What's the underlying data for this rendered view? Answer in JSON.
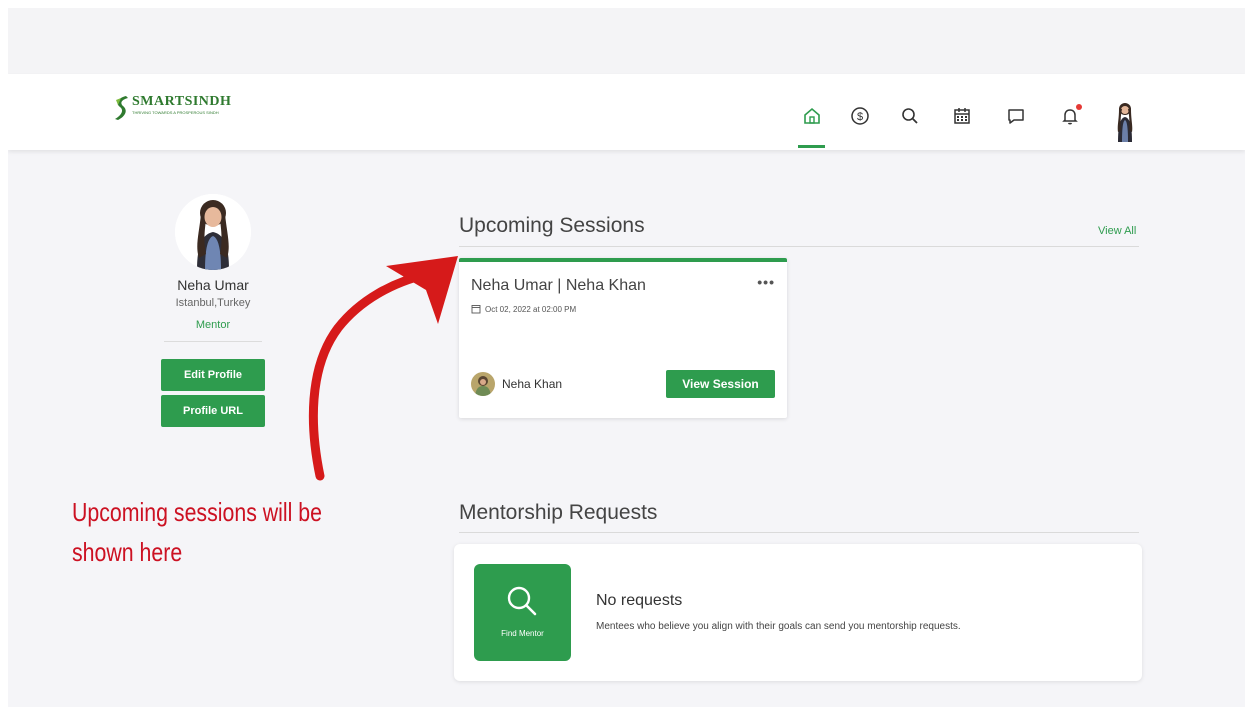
{
  "app": {
    "logo_name": "SMARTSINDH",
    "logo_tagline": "THRIVING TOWARDS A PROSPEROUS SINDH"
  },
  "nav": {
    "items": [
      "home-icon",
      "dollar-icon",
      "search-icon",
      "calendar-icon",
      "message-icon",
      "bell-icon"
    ],
    "active": "home-icon",
    "has_notification": true
  },
  "profile": {
    "name": "Neha Umar",
    "location": "Istanbul,Turkey",
    "role": "Mentor",
    "edit_label": "Edit Profile",
    "url_label": "Profile URL"
  },
  "upcoming": {
    "title": "Upcoming Sessions",
    "view_all": "View All",
    "sessions": [
      {
        "title": "Neha Umar | Neha Khan",
        "date": "Oct 02, 2022 at 02:00 PM",
        "mentee": "Neha Khan",
        "action": "View Session"
      }
    ]
  },
  "requests": {
    "title": "Mentorship Requests",
    "tile_label": "Find Mentor",
    "empty_title": "No requests",
    "empty_desc": "Mentees who believe you align with their goals can send you mentorship requests."
  },
  "annotation": {
    "text": "Upcoming sessions will be shown here"
  },
  "colors": {
    "accent": "#2e9c4e",
    "annotation": "#cc1122",
    "notification": "#e53935"
  }
}
